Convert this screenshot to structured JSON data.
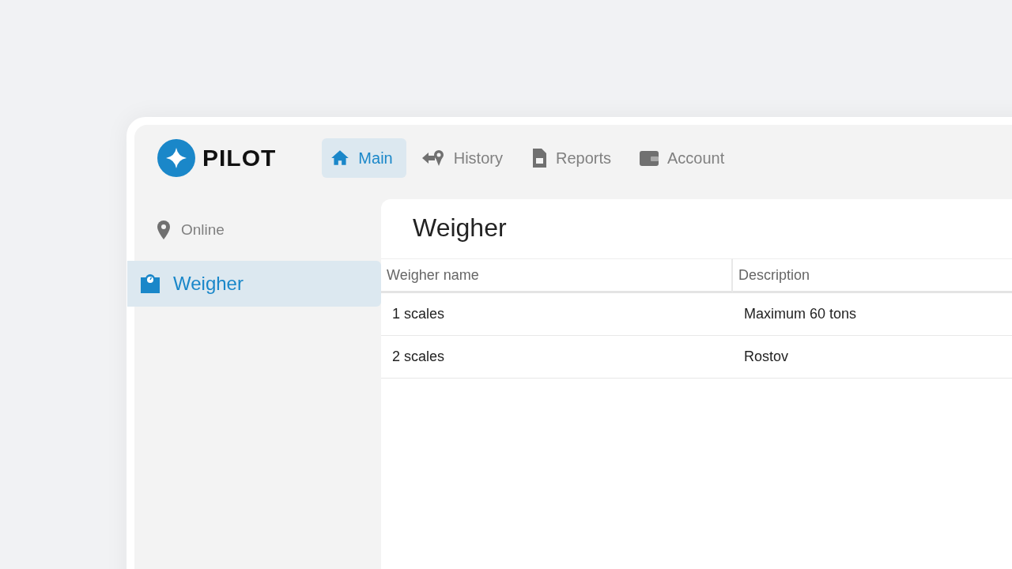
{
  "logo": {
    "text": "PILOT"
  },
  "nav": [
    {
      "label": "Main",
      "selected": true
    },
    {
      "label": "History",
      "selected": false
    },
    {
      "label": "Reports",
      "selected": false
    },
    {
      "label": "Account",
      "selected": false
    }
  ],
  "sidebar": {
    "items": [
      {
        "label": "Online",
        "selected": false
      },
      {
        "label": "Weigher",
        "selected": true
      }
    ]
  },
  "page": {
    "title": "Weigher"
  },
  "table": {
    "columns": [
      "Weigher name",
      "Description"
    ],
    "rows": [
      [
        "1 scales",
        "Maximum 60 tons"
      ],
      [
        "2 scales",
        "Rostov"
      ]
    ]
  }
}
